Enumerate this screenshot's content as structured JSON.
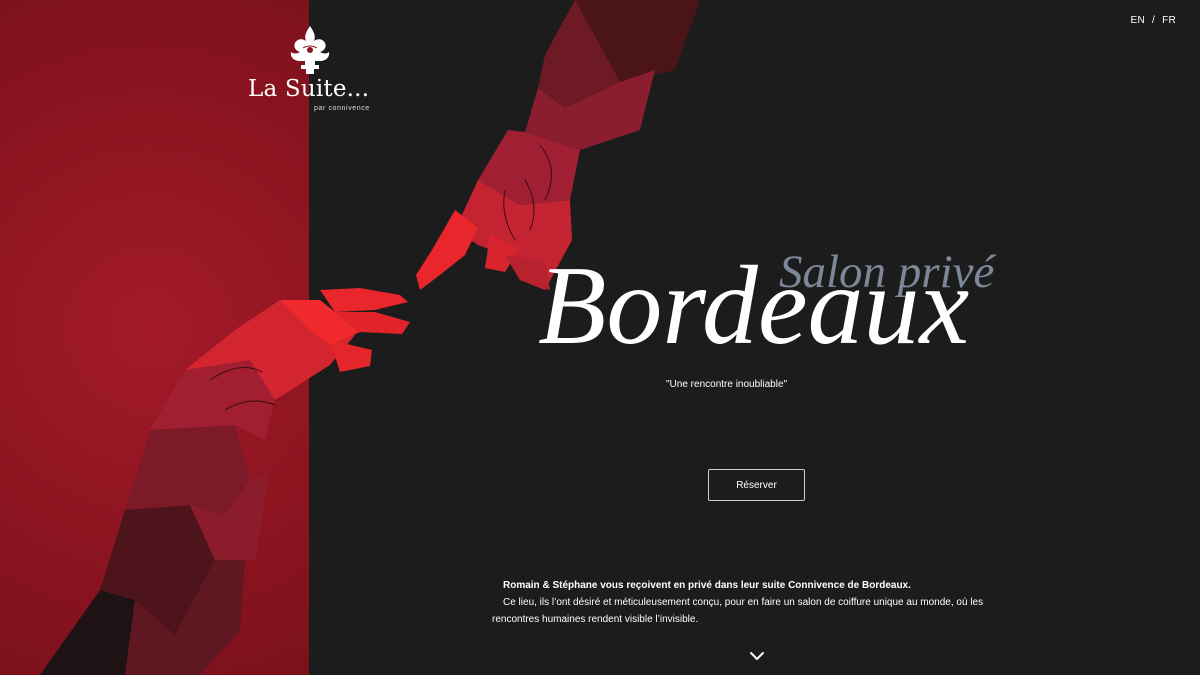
{
  "brand": {
    "name": "La Suite...",
    "tagline": "par connivence",
    "logo_icon": "fleur-de-lis-icon"
  },
  "language": {
    "en": "EN",
    "separator": "/",
    "fr": "FR"
  },
  "hero": {
    "subtitle": "Salon privé",
    "title": "Bordeaux",
    "quote": "\"Une rencontre inoubliable\"",
    "cta_label": "Réserver"
  },
  "intro": {
    "lead": "Romain & Stéphane vous reçoivent en privé dans leur suite Connivence de Bordeaux.",
    "body": "Ce lieu, ils l’ont désiré et méticuleusement conçu, pour en faire un salon de coiffure unique au monde, où les rencontres humaines rendent visible l’invisible."
  },
  "icons": {
    "scroll": "chevron-down-icon"
  },
  "colors": {
    "panel_red": "#8e1420",
    "background": "#1c1c1c",
    "hand_red": "#e8262b",
    "subtitle_gray": "#7d8798",
    "text": "#ffffff"
  }
}
